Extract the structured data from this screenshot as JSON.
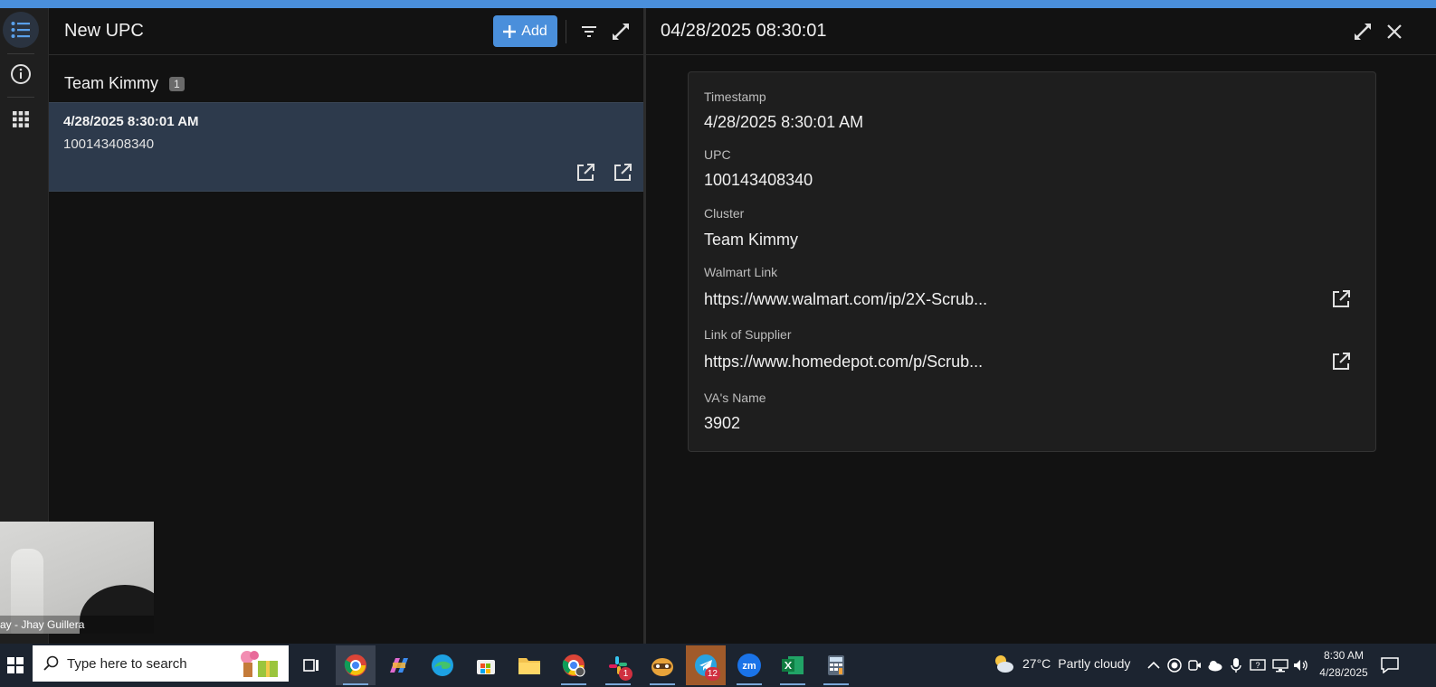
{
  "list_panel": {
    "title": "New UPC",
    "add_label": "Add",
    "group": {
      "name": "Team Kimmy",
      "count": "1"
    },
    "items": [
      {
        "timestamp": "4/28/2025 8:30:01 AM",
        "upc": "100143408340"
      }
    ]
  },
  "detail_panel": {
    "title": "04/28/2025 08:30:01",
    "fields": [
      {
        "label": "Timestamp",
        "value": "4/28/2025 8:30:01 AM"
      },
      {
        "label": "UPC",
        "value": "100143408340"
      },
      {
        "label": "Cluster",
        "value": "Team Kimmy"
      },
      {
        "label": "Walmart Link",
        "value": "https://www.walmart.com/ip/2X-Scrub..."
      },
      {
        "label": "Link of Supplier",
        "value": "https://www.homedepot.com/p/Scrub..."
      },
      {
        "label": "VA's Name",
        "value": "3902"
      }
    ]
  },
  "webcam": {
    "label": "ay - Jhay Guillera"
  },
  "taskbar": {
    "search_placeholder": "Type here to search",
    "weather_temp": "27°C",
    "weather_desc": "Partly cloudy",
    "time": "8:30 AM",
    "date": "4/28/2025",
    "badges": {
      "slack": "1",
      "telegram": "12"
    }
  },
  "colors": {
    "accent": "#4a8fdb",
    "selected_row": "#2d3a4c",
    "background": "#121212",
    "card": "#1e1e1e"
  }
}
